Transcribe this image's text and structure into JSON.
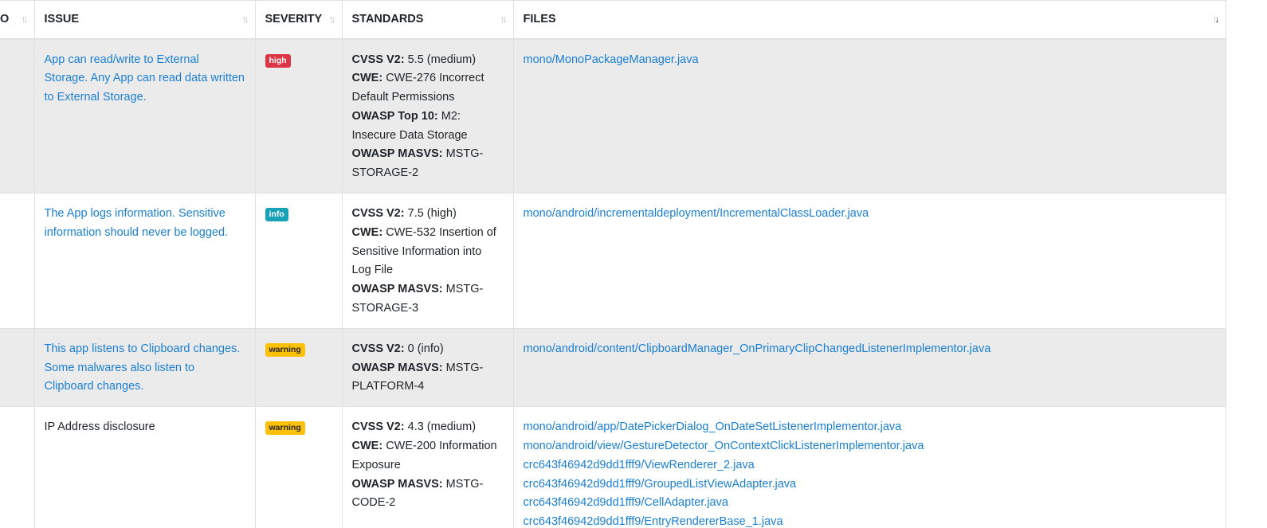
{
  "headers": {
    "no": "O",
    "issue": "ISSUE",
    "severity": "SEVERITY",
    "standards": "STANDARDS",
    "files": "FILES"
  },
  "rows": [
    {
      "issue": "App can read/write to External Storage. Any App can read data written to External Storage.",
      "issue_is_link": true,
      "severity": "high",
      "standards": [
        {
          "label": "CVSS V2:",
          "value": "5.5 (medium)"
        },
        {
          "label": "CWE:",
          "value": "CWE-276 Incorrect Default Permissions"
        },
        {
          "label": "OWASP Top 10:",
          "value": "M2: Insecure Data Storage"
        },
        {
          "label": "OWASP MASVS:",
          "value": "MSTG-STORAGE-2"
        }
      ],
      "files": [
        "mono/MonoPackageManager.java"
      ]
    },
    {
      "issue": "The App logs information. Sensitive information should never be logged.",
      "issue_is_link": true,
      "severity": "info",
      "standards": [
        {
          "label": "CVSS V2:",
          "value": "7.5 (high)"
        },
        {
          "label": "CWE:",
          "value": "CWE-532 Insertion of Sensitive Information into Log File"
        },
        {
          "label": "OWASP MASVS:",
          "value": "MSTG-STORAGE-3"
        }
      ],
      "files": [
        "mono/android/incrementaldeployment/IncrementalClassLoader.java"
      ]
    },
    {
      "issue": "This app listens to Clipboard changes. Some malwares also listen to Clipboard changes.",
      "issue_is_link": true,
      "severity": "warning",
      "standards": [
        {
          "label": "CVSS V2:",
          "value": "0 (info)"
        },
        {
          "label": "OWASP MASVS:",
          "value": "MSTG-PLATFORM-4"
        }
      ],
      "files": [
        "mono/android/content/ClipboardManager_OnPrimaryClipChangedListenerImplementor.java"
      ]
    },
    {
      "issue": "IP Address disclosure",
      "issue_is_link": false,
      "severity": "warning",
      "standards": [
        {
          "label": "CVSS V2:",
          "value": "4.3 (medium)"
        },
        {
          "label": "CWE:",
          "value": "CWE-200 Information Exposure"
        },
        {
          "label": "OWASP MASVS:",
          "value": "MSTG-CODE-2"
        }
      ],
      "files": [
        "mono/android/app/DatePickerDialog_OnDateSetListenerImplementor.java",
        "mono/android/view/GestureDetector_OnContextClickListenerImplementor.java",
        "crc643f46942d9dd1fff9/ViewRenderer_2.java",
        "crc643f46942d9dd1fff9/GroupedListViewAdapter.java",
        "crc643f46942d9dd1fff9/CellAdapter.java",
        "crc643f46942d9dd1fff9/EntryRendererBase_1.java"
      ]
    }
  ],
  "colors": {
    "link": "#1a7fd4",
    "high": "#dc3545",
    "info": "#17a2b8",
    "warning": "#ffc107",
    "stripe": "#ebebeb"
  }
}
